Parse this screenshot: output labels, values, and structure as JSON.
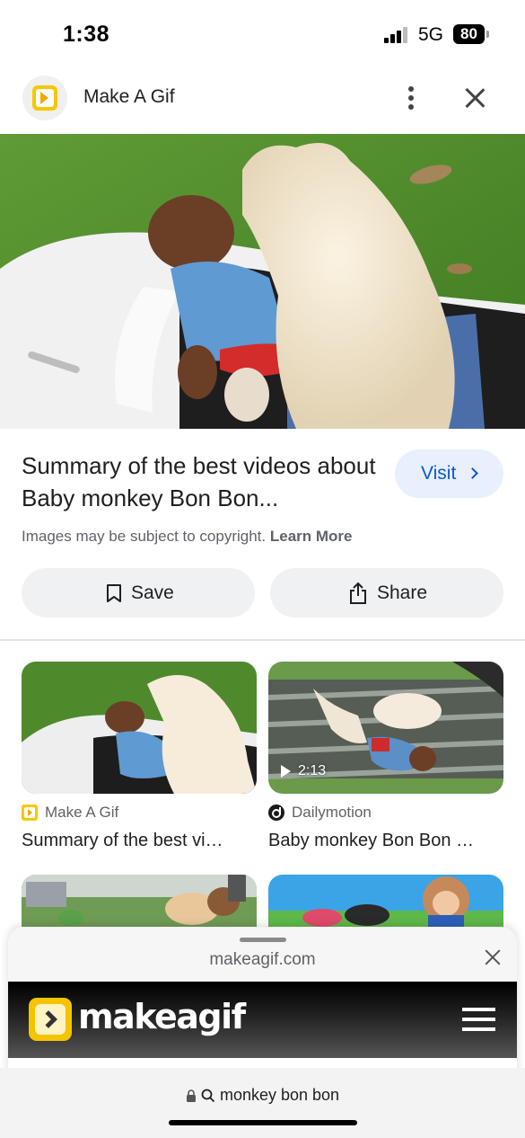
{
  "status_bar": {
    "time": "1:38",
    "network": "5G",
    "battery": "80"
  },
  "header": {
    "site_name": "Make A Gif"
  },
  "result": {
    "title": "Summary of the best videos about Baby monkey Bon Bon...",
    "visit_label": "Visit",
    "copyright_text": "Images may be subject to copyright.",
    "learn_more": "Learn More",
    "save_label": "Save",
    "share_label": "Share"
  },
  "related": [
    {
      "source": "Make A Gif",
      "title": "Summary of the best vi…",
      "duration": ""
    },
    {
      "source": "Dailymotion",
      "title": "Baby monkey Bon Bon …",
      "duration": "2:13"
    }
  ],
  "sheet": {
    "domain": "makeagif.com",
    "logo_text": "makeagif"
  },
  "address_bar": {
    "query": "monkey bon bon"
  }
}
